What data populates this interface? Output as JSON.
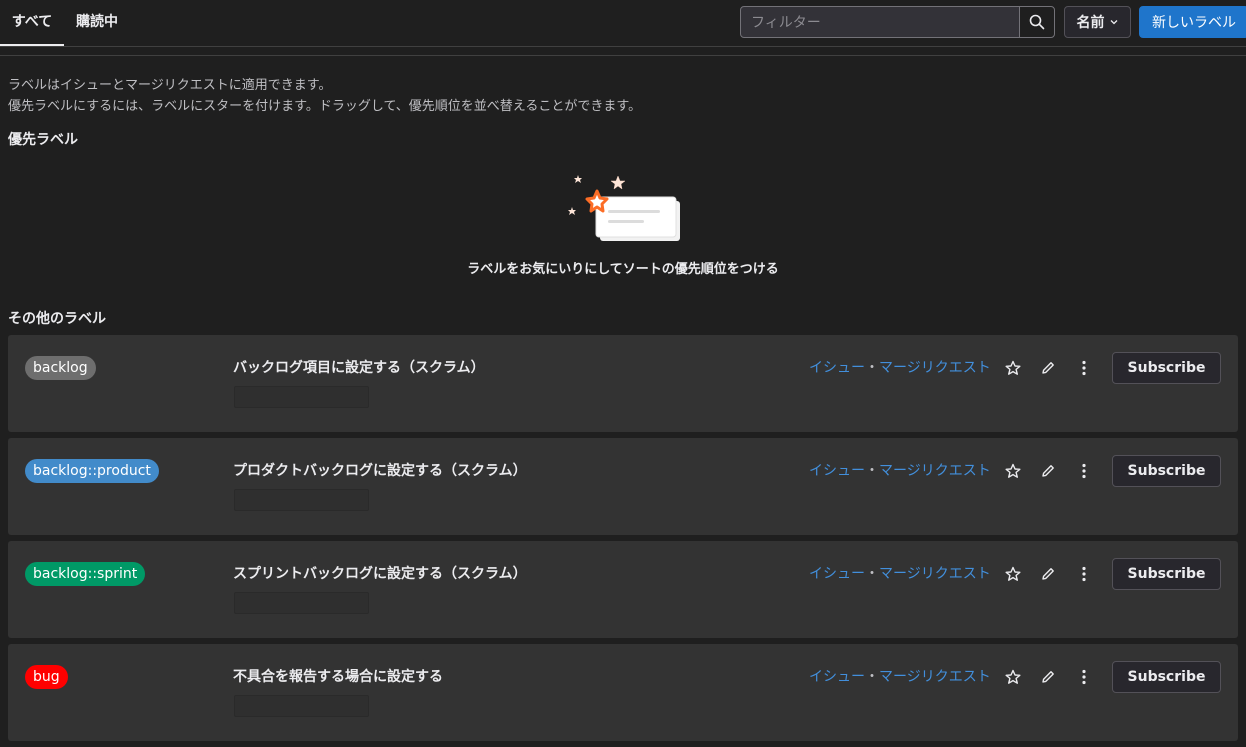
{
  "tabs": {
    "all": "すべて",
    "subscribed": "購読中"
  },
  "toolbar": {
    "filter_placeholder": "フィルター",
    "sort_label": "名前",
    "new_label_button": "新しいラベル"
  },
  "description": {
    "line1": "ラベルはイシューとマージリクエストに適用できます。",
    "line2": "優先ラベルにするには、ラベルにスターを付けます。ドラッグして、優先順位を並べ替えることができます。"
  },
  "priority_section": {
    "title": "優先ラベル",
    "empty_text": "ラベルをお気にいりにしてソートの優先順位をつける"
  },
  "other_section": {
    "title": "その他のラベル"
  },
  "labels": [
    {
      "name": "backlog",
      "color": "#6e6e6e",
      "description": "バックログ項目に設定する（スクラム）",
      "link_issues": "イシュー",
      "separator": "・",
      "link_mrs": "マージリクエスト",
      "subscribe": "Subscribe"
    },
    {
      "name": "backlog::product",
      "color": "#428bca",
      "description": "プロダクトバックログに設定する（スクラム）",
      "link_issues": "イシュー",
      "separator": "・",
      "link_mrs": "マージリクエスト",
      "subscribe": "Subscribe"
    },
    {
      "name": "backlog::sprint",
      "color": "#009966",
      "description": "スプリントバックログに設定する（スクラム）",
      "link_issues": "イシュー",
      "separator": "・",
      "link_mrs": "マージリクエスト",
      "subscribe": "Subscribe"
    },
    {
      "name": "bug",
      "color": "#ff0000",
      "description": "不具合を報告する場合に設定する",
      "link_issues": "イシュー",
      "separator": "・",
      "link_mrs": "マージリクエスト",
      "subscribe": "Subscribe"
    }
  ],
  "colors": {
    "accent_blue": "#1f75cb",
    "link_blue": "#428fdc",
    "star_orange": "#fc6d26"
  },
  "icons": {
    "search": "search-icon",
    "chevron": "chevron-down-icon",
    "star": "star-icon",
    "edit": "pencil-icon",
    "more": "ellipsis-v-icon"
  }
}
